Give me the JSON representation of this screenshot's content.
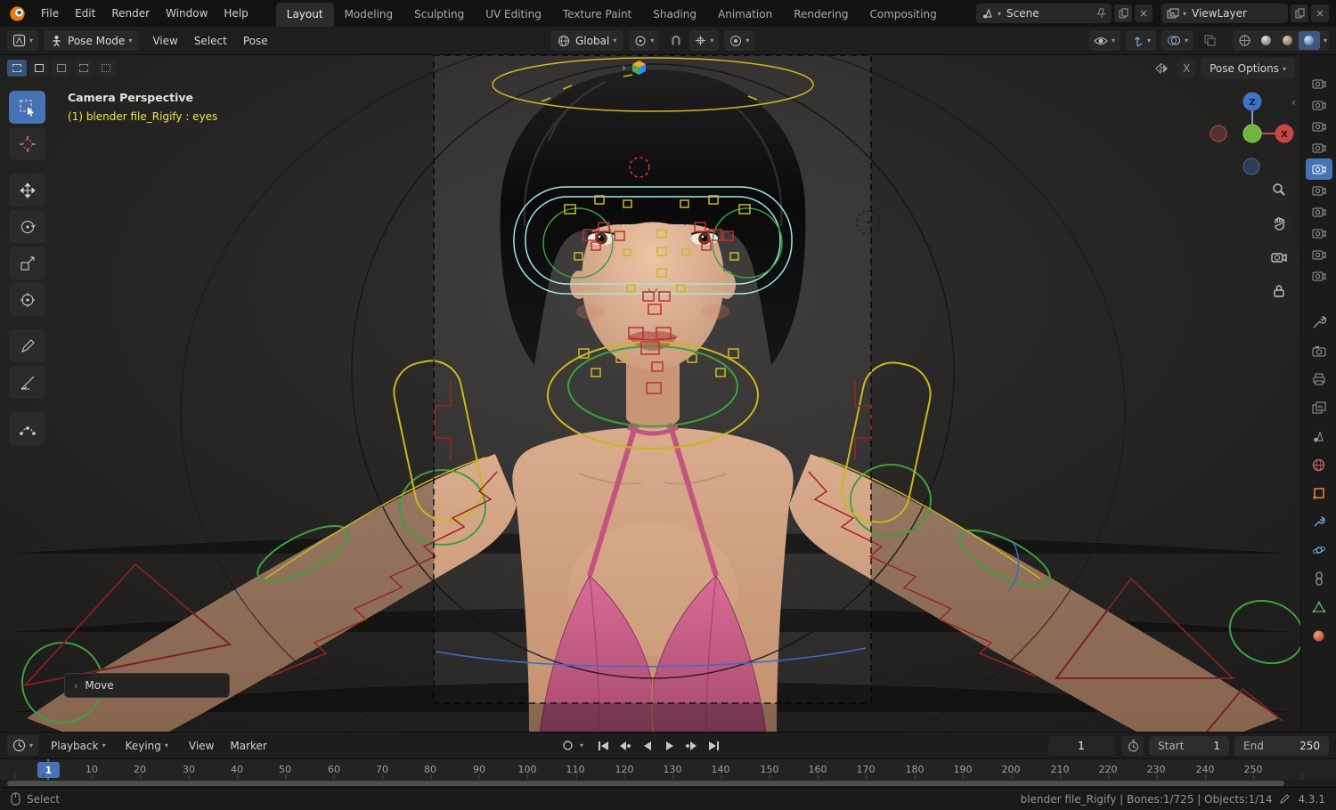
{
  "topbar": {
    "menus": [
      "File",
      "Edit",
      "Render",
      "Window",
      "Help"
    ],
    "tabs": [
      "Layout",
      "Modeling",
      "Sculpting",
      "UV Editing",
      "Texture Paint",
      "Shading",
      "Animation",
      "Rendering",
      "Compositing"
    ],
    "active_tab": "Layout",
    "scene_label": "Scene",
    "viewlayer_label": "ViewLayer"
  },
  "header": {
    "mode_label": "Pose Mode",
    "menus": [
      "View",
      "Select",
      "Pose"
    ],
    "orientation_label": "Global"
  },
  "tool_settings": {
    "select_modes": [
      "new",
      "extend",
      "subtract",
      "invert",
      "intersect"
    ],
    "mirror_x_label": "X",
    "pose_options_label": "Pose Options"
  },
  "viewport": {
    "view_label": "Camera Perspective",
    "context_label": "(1) blender file_Rigify : eyes",
    "move_panel_label": "Move",
    "active_tool": "select-box",
    "tools": [
      "select-box",
      "cursor",
      "move",
      "rotate",
      "scale",
      "transform",
      "annotate",
      "measure",
      "pose-breakdowner"
    ],
    "gizmo": {
      "z_label": "Z",
      "x_label": "X"
    }
  },
  "right_panel": {
    "outliner_items": [
      "camera",
      "camera",
      "camera",
      "camera",
      "camera",
      "camera",
      "camera",
      "camera",
      "camera",
      "camera"
    ],
    "properties_tabs": [
      "tool",
      "render",
      "output",
      "view-layer",
      "scene",
      "world",
      "object",
      "modifiers",
      "physics",
      "constraints",
      "data",
      "material"
    ]
  },
  "timeline": {
    "menus": [
      "Playback",
      "Keying",
      "View",
      "Marker"
    ],
    "current_frame": "1",
    "start_label": "Start",
    "start_value": "1",
    "end_label": "End",
    "end_value": "250",
    "ruler": [
      "10",
      "20",
      "30",
      "40",
      "50",
      "60",
      "70",
      "80",
      "90",
      "100",
      "110",
      "120",
      "130",
      "140",
      "150",
      "160",
      "170",
      "180",
      "190",
      "200",
      "210",
      "220",
      "230",
      "240",
      "250"
    ]
  },
  "statusbar": {
    "left_label": "Select",
    "info": "blender file_Rigify | Bones:1/725 | Objects:1/14",
    "version": "4.3.1"
  },
  "colors": {
    "accent": "#4772b3",
    "highlight_yellow": "#ece54e",
    "rig_yellow": "#ccb61e",
    "rig_red": "#c03030",
    "rig_green": "#3da03d",
    "rig_cyan": "#9fe8e4"
  }
}
